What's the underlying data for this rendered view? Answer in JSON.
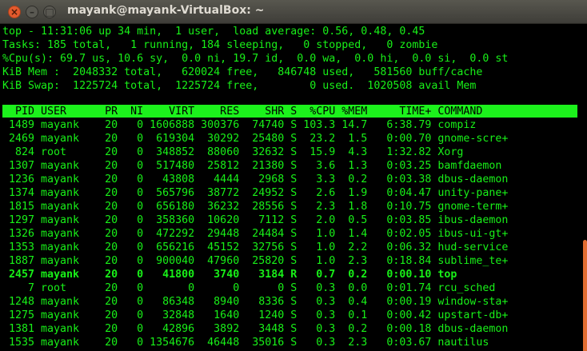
{
  "window": {
    "title": "mayank@mayank-VirtualBox: ~"
  },
  "summary": [
    "top - 11:31:06 up 34 min,  1 user,  load average: 0.56, 0.48, 0.45",
    "Tasks: 185 total,   1 running, 184 sleeping,   0 stopped,   0 zombie",
    "%Cpu(s): 69.7 us, 10.6 sy,  0.0 ni, 19.7 id,  0.0 wa,  0.0 hi,  0.0 si,  0.0 st",
    "KiB Mem :  2048332 total,   620024 free,   846748 used,   581560 buff/cache",
    "KiB Swap:  1225724 total,  1225724 free,        0 used.  1020508 avail Mem"
  ],
  "header": "  PID USER      PR  NI    VIRT    RES    SHR S  %CPU %MEM     TIME+ COMMAND",
  "processes": [
    " 1489 mayank    20   0 1606888 300376  74740 S 103.3 14.7   6:38.79 compiz",
    " 2469 mayank    20   0  619304  30292  25480 S  23.2  1.5   0:00.70 gnome-scre+",
    "  824 root      20   0  348852  88060  32632 S  15.9  4.3   1:32.82 Xorg",
    " 1307 mayank    20   0  517480  25812  21380 S   3.6  1.3   0:03.25 bamfdaemon",
    " 1236 mayank    20   0   43808   4444   2968 S   3.3  0.2   0:03.38 dbus-daemon",
    " 1374 mayank    20   0  565796  38772  24952 S   2.6  1.9   0:04.47 unity-pane+",
    " 1815 mayank    20   0  656180  36232  28556 S   2.3  1.8   0:10.75 gnome-term+",
    " 1297 mayank    20   0  358360  10620   7112 S   2.0  0.5   0:03.85 ibus-daemon",
    " 1326 mayank    20   0  472292  29448  24484 S   1.0  1.4   0:02.05 ibus-ui-gt+",
    " 1353 mayank    20   0  656216  45152  32756 S   1.0  2.2   0:06.32 hud-service",
    " 1887 mayank    20   0  900040  47960  25820 S   1.0  2.3   0:18.84 sublime_te+",
    " 2457 mayank    20   0   41800   3740   3184 R   0.7  0.2   0:00.10 top",
    "    7 root      20   0       0      0      0 S   0.3  0.0   0:01.74 rcu_sched",
    " 1248 mayank    20   0   86348   8940   8336 S   0.3  0.4   0:00.19 window-sta+",
    " 1275 mayank    20   0   32848   1640   1240 S   0.3  0.1   0:00.42 upstart-db+",
    " 1381 mayank    20   0   42896   3892   3448 S   0.3  0.2   0:00.18 dbus-daemon",
    " 1535 mayank    20   0 1354676  46448  35016 S   0.3  2.3   0:03.67 nautilus"
  ],
  "colors": {
    "text": "#18f018",
    "header_bar": "#1cf21c",
    "background": "#000000"
  }
}
